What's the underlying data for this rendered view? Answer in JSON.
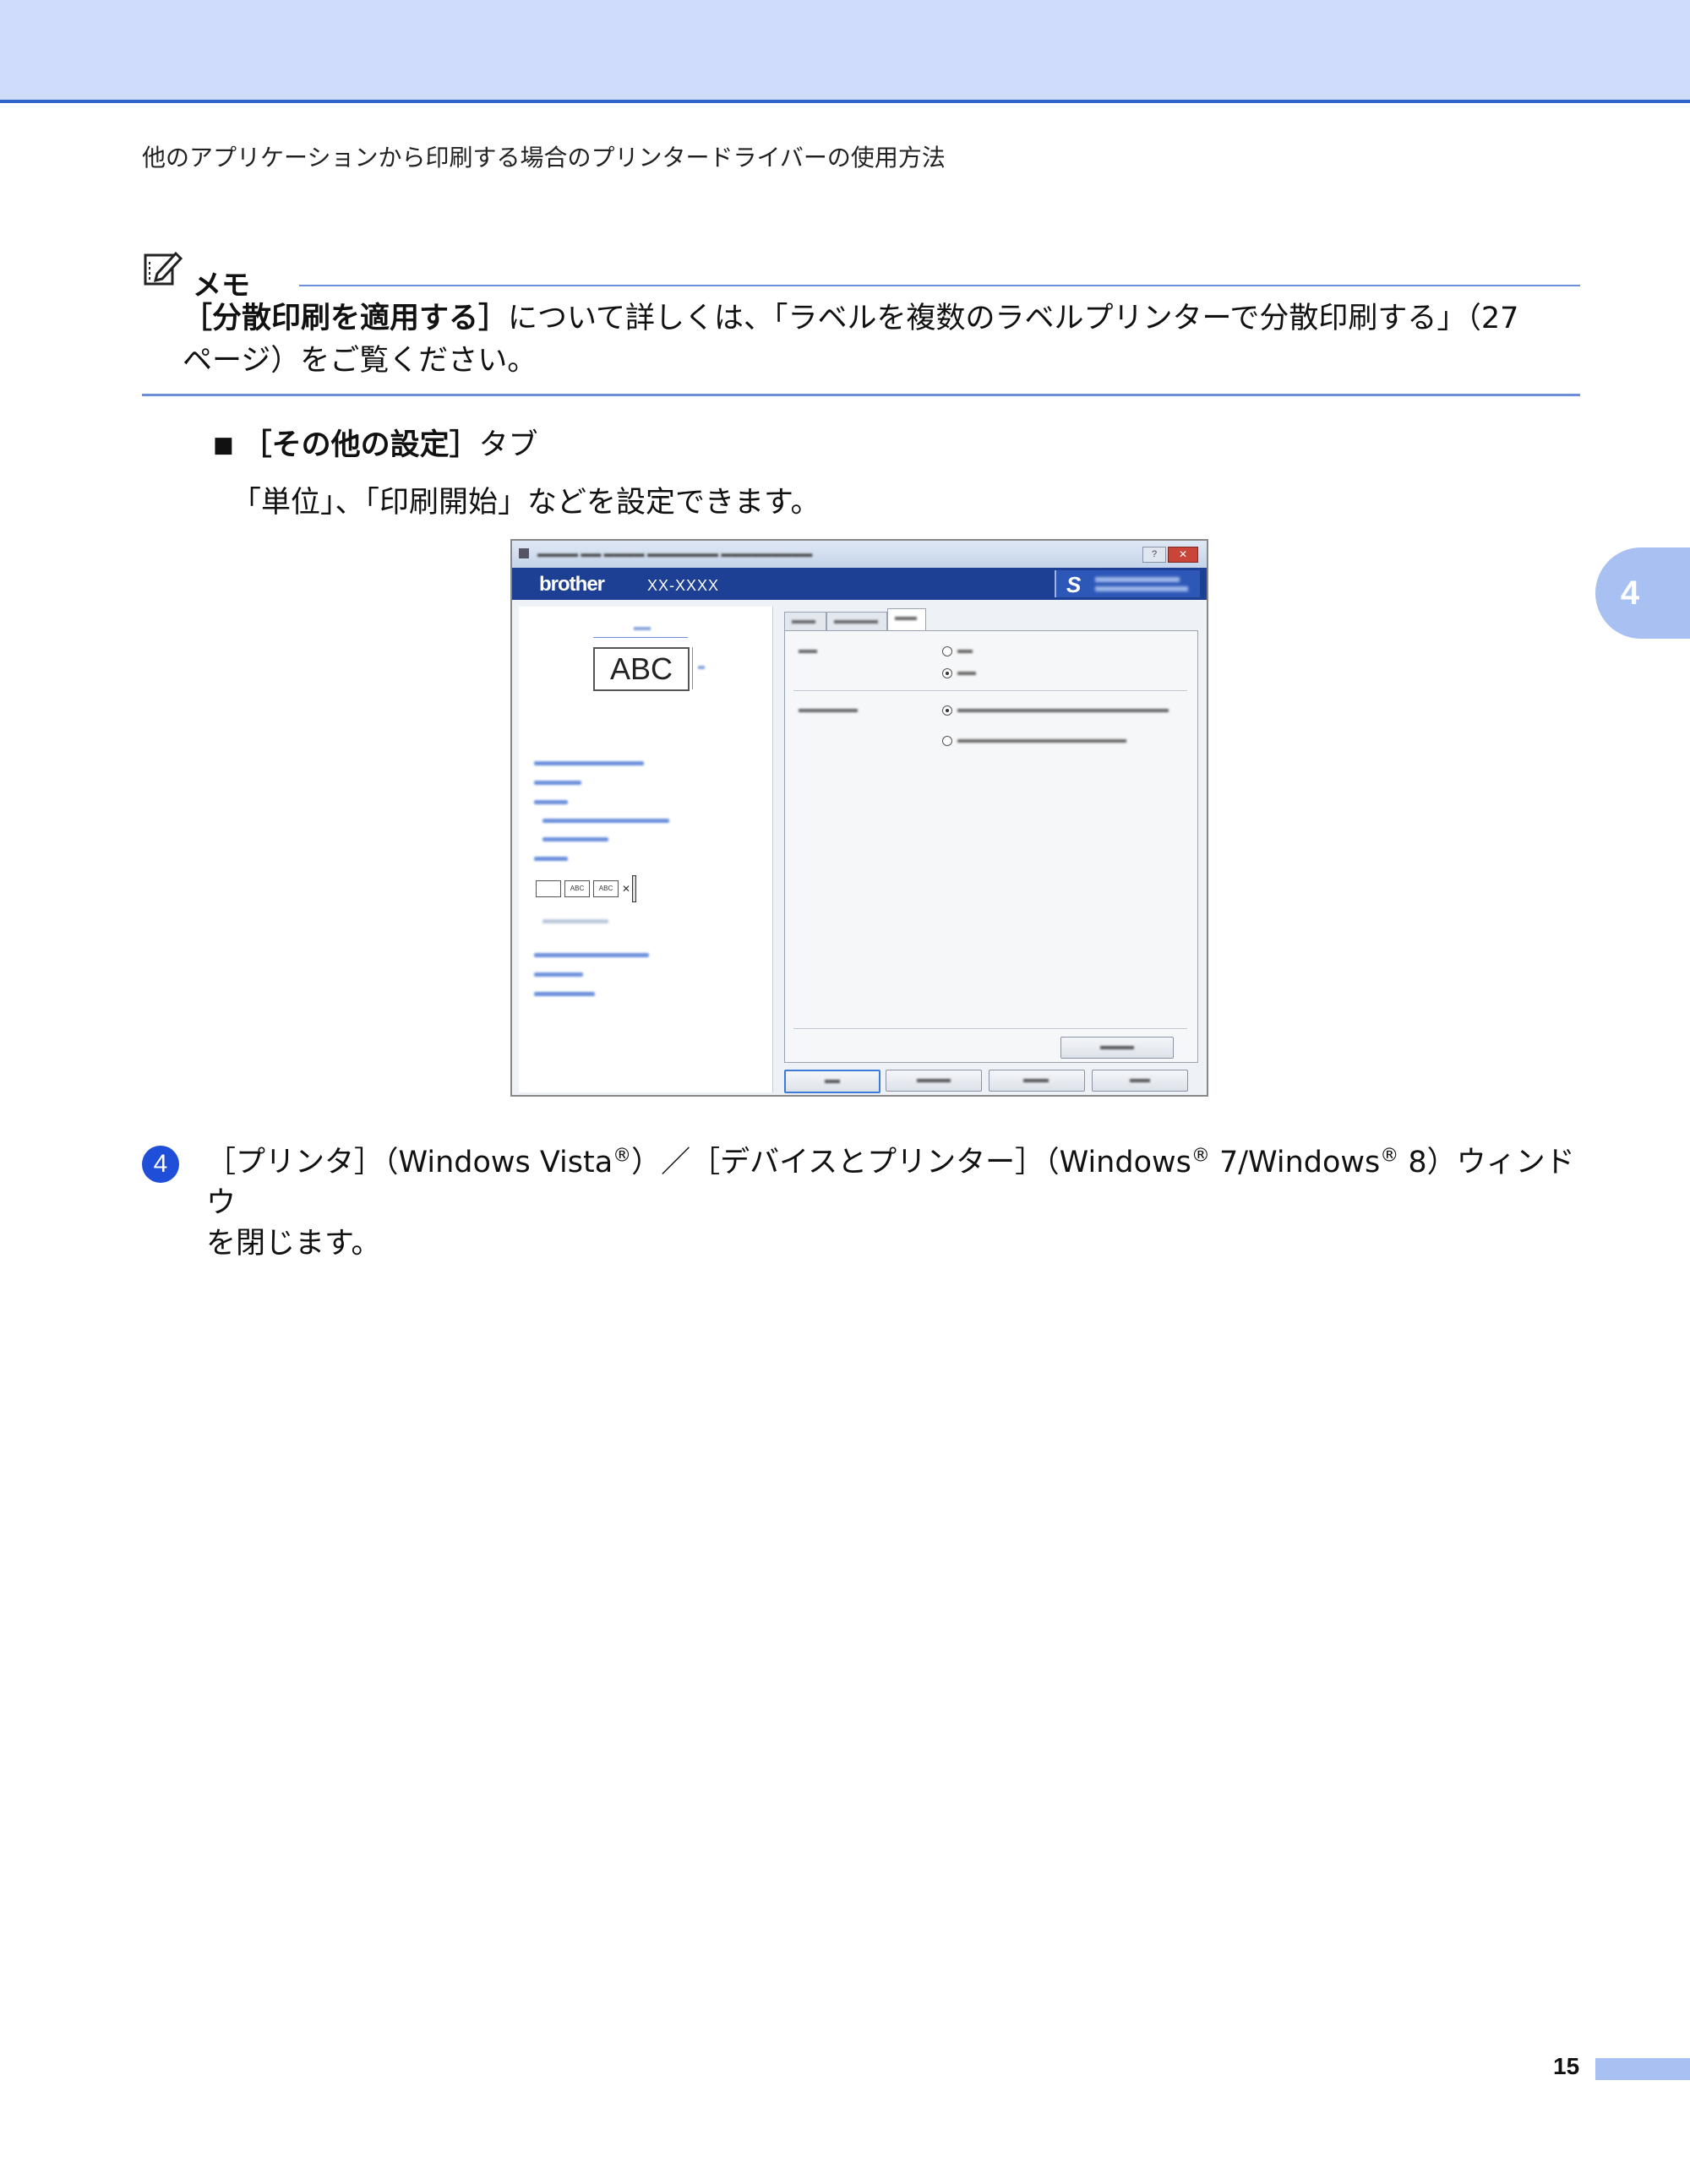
{
  "header": {
    "title": "他のアプリケーションから印刷する場合のプリンタードライバーの使用方法"
  },
  "chapter_tab": "4",
  "memo": {
    "title": "メモ",
    "body_emph": "［分散印刷を適用する］",
    "body_line1_rest": "について詳しくは、「ラベルを複数のラベルプリンターで分散印刷する」（27",
    "body_line2": "ページ）をご覧ください。"
  },
  "bullet": {
    "emph": "［その他の設定］",
    "rest": "タブ",
    "description": "「単位」、「印刷開始」などを設定できます。"
  },
  "dialog": {
    "help_label": "?",
    "close_label": "✕",
    "brand": "brother",
    "model": "XX-XXXX",
    "abc": "ABC",
    "option_icon_1": "ABC",
    "option_icon_2": "ABC",
    "option_cut": "✕"
  },
  "step": {
    "number": "4",
    "text_a": "［プリンタ］（Windows Vista",
    "reg": "®",
    "text_b": "）／［デバイスとプリンター］（Windows",
    "text_c": " 7/Windows",
    "text_d": " 8）ウィンドウ",
    "text_line2": "を閉じます。"
  },
  "page_number": "15",
  "colors": {
    "accent": "#2f63c8",
    "band": "#cfdcfb",
    "tab": "#a9c0f2",
    "step_circle": "#1f4fd8"
  }
}
